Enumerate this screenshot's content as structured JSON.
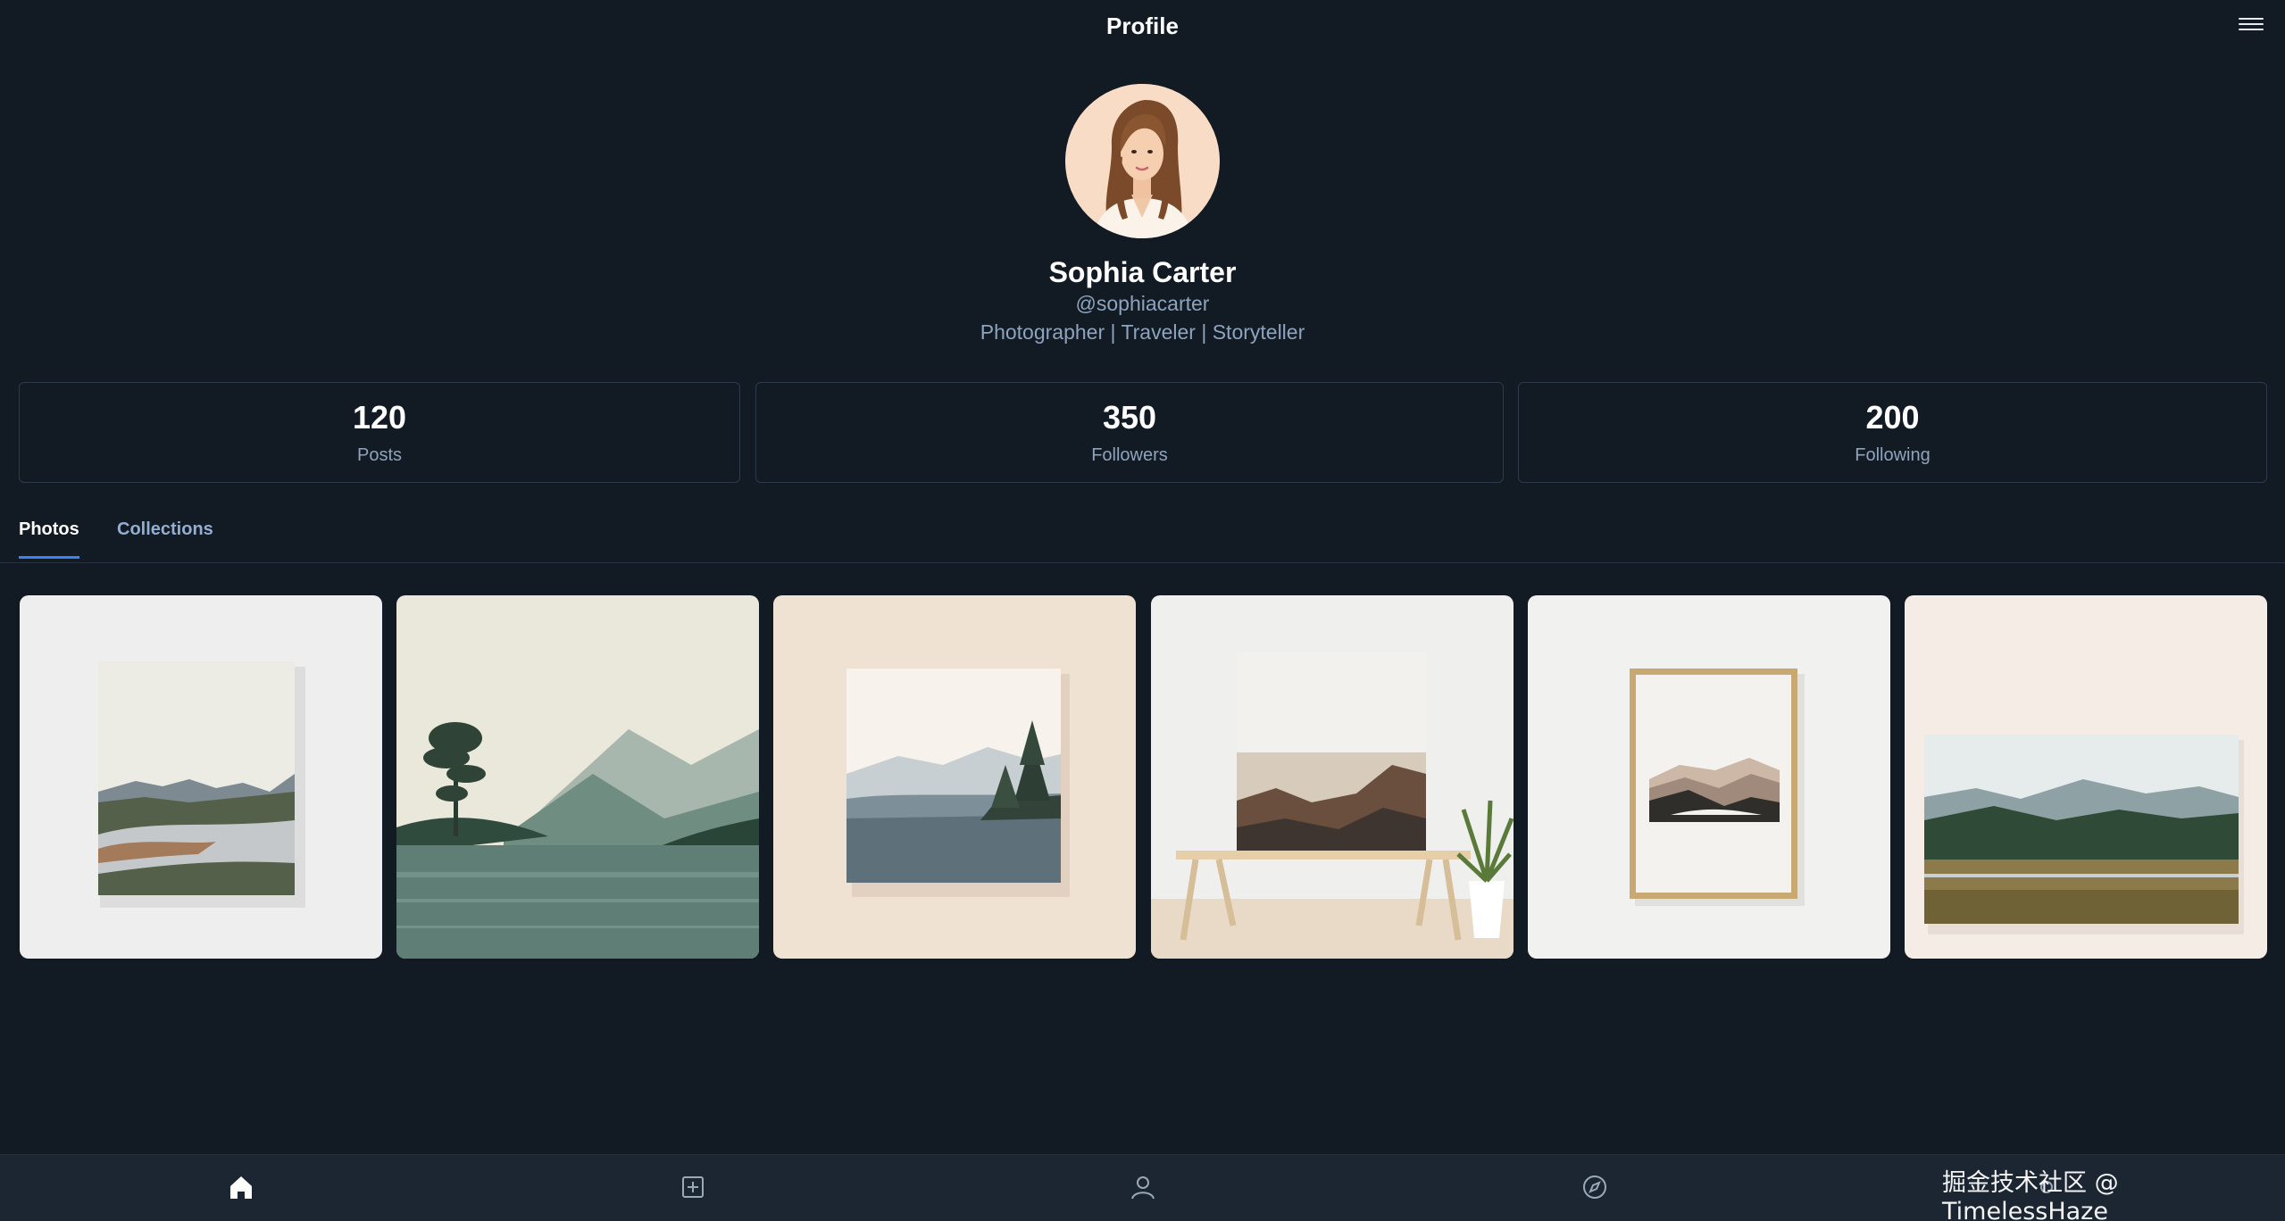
{
  "header": {
    "title": "Profile"
  },
  "profile": {
    "name": "Sophia Carter",
    "handle": "@sophiacarter",
    "bio": "Photographer | Traveler | Storyteller"
  },
  "stats": [
    {
      "value": "120",
      "label": "Posts"
    },
    {
      "value": "350",
      "label": "Followers"
    },
    {
      "value": "200",
      "label": "Following"
    }
  ],
  "tabs": [
    {
      "label": "Photos",
      "active": true
    },
    {
      "label": "Collections",
      "active": false
    }
  ],
  "photos": [
    {
      "name": "framed-river-print"
    },
    {
      "name": "lake-tree-landscape"
    },
    {
      "name": "misty-lake-pine-print"
    },
    {
      "name": "mountain-print-on-bench"
    },
    {
      "name": "abstract-hills-framed"
    },
    {
      "name": "valley-field-print"
    }
  ],
  "bottom_nav": [
    {
      "icon": "home-icon",
      "active": true
    },
    {
      "icon": "add-post-icon",
      "active": false
    },
    {
      "icon": "profile-icon",
      "active": false
    },
    {
      "icon": "explore-icon",
      "active": false
    },
    {
      "icon": "settings-icon",
      "active": false
    }
  ],
  "watermark": "掘金技术社区 @ TimelessHaze",
  "colors": {
    "background": "#121a24",
    "accent": "#3b82f6",
    "muted_text": "#8ea3bd"
  }
}
